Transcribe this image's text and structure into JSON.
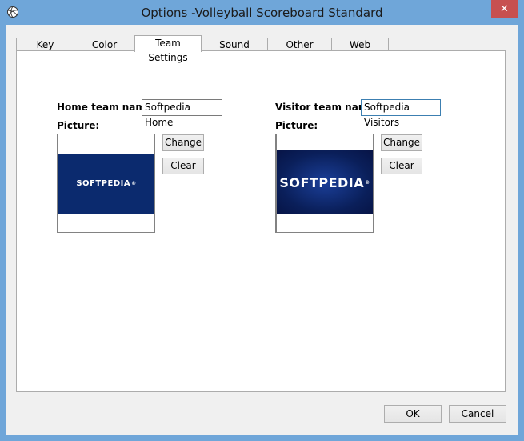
{
  "window": {
    "title": "Options -Volleyball Scoreboard Standard",
    "close_symbol": "✕"
  },
  "tabs": [
    {
      "label": "Key Settings",
      "active": false
    },
    {
      "label": "Color Settings",
      "active": false
    },
    {
      "label": "Team Settings",
      "active": true
    },
    {
      "label": "Sound Settings",
      "active": false
    },
    {
      "label": "Other Settings",
      "active": false
    },
    {
      "label": "Web Remote",
      "active": false
    }
  ],
  "home": {
    "name_label": "Home team name:",
    "name_value": "Softpedia Home",
    "picture_label": "Picture:",
    "picture_text": "SOFTPEDIA",
    "picture_color": "#0b2a6e",
    "change_label": "Change",
    "clear_label": "Clear"
  },
  "visitor": {
    "name_label": "Visitor team name:",
    "name_value": "Softpedia Visitors",
    "picture_label": "Picture:",
    "picture_text": "SOFTPEDIA",
    "picture_color": "#0a1f5a",
    "change_label": "Change",
    "clear_label": "Clear"
  },
  "footer": {
    "ok_label": "OK",
    "cancel_label": "Cancel"
  },
  "colors": {
    "frame": "#6fa6d9",
    "close": "#c75050",
    "client": "#f0f0f0"
  }
}
